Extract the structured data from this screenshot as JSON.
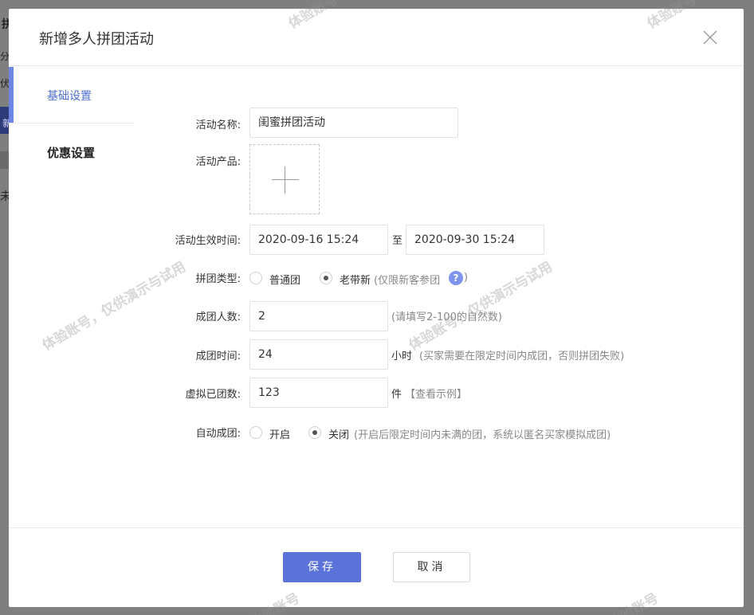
{
  "background": {
    "fragments": [
      "拼",
      "分",
      "伏",
      "新",
      "未"
    ]
  },
  "watermark": {
    "text": "体验账号，仅供演示与试用",
    "short": "体验账号",
    "short2": "体验账号，仅供演示与试用"
  },
  "modal": {
    "title": "新增多人拼团活动",
    "close_icon": "close-icon"
  },
  "sidebar": {
    "items": [
      {
        "label": "基础设置",
        "active": true
      },
      {
        "label": "优惠设置",
        "active": false
      }
    ]
  },
  "form": {
    "name": {
      "label": "活动名称:",
      "value": "闺蜜拼团活动"
    },
    "product": {
      "label": "活动产品:",
      "icon": "plus-icon"
    },
    "time": {
      "label": "活动生效时间:",
      "start": "2020-09-16 15:24",
      "separator": "至",
      "end": "2020-09-30 15:24"
    },
    "type": {
      "label": "拼团类型:",
      "options": [
        "普通团",
        "老带新"
      ],
      "selected": "老带新",
      "hint": "(仅限新客参团",
      "help_icon": "?",
      "hint_close": ")"
    },
    "size": {
      "label": "成团人数:",
      "value": "2",
      "hint": "(请填写2-100的自然数)"
    },
    "duration": {
      "label": "成团时间:",
      "value": "24",
      "unit": "小时",
      "hint": "(买家需要在限定时间内成团，否则拼团失败)"
    },
    "virtual": {
      "label": "虚拟已团数:",
      "value": "123",
      "unit": "件",
      "link": "【查看示例】"
    },
    "auto": {
      "label": "自动成团:",
      "options": [
        "开启",
        "关闭"
      ],
      "selected": "关闭",
      "hint": "(开启后限定时间内未满的团，系统以匿名买家模拟成团)"
    }
  },
  "footer": {
    "save": "保存",
    "cancel": "取消"
  }
}
